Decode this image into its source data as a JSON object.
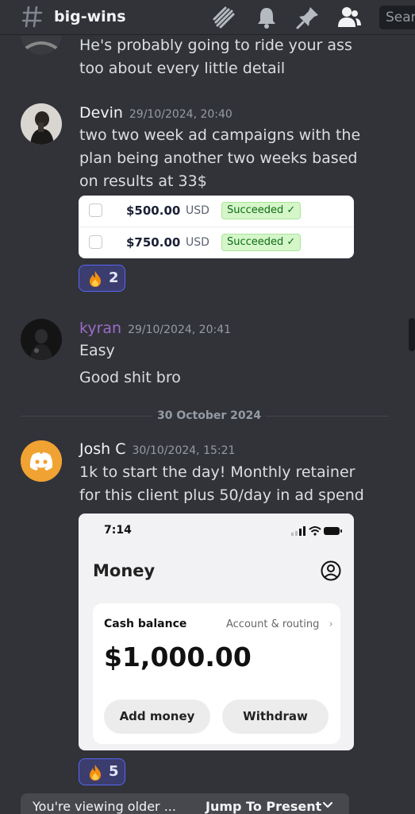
{
  "header": {
    "channel_name": "big-wins",
    "search_placeholder": "Sear"
  },
  "top_message": {
    "text_line1": "He's probably going to ride your ass",
    "text_line2": "too about every little detail"
  },
  "msg_devin": {
    "author": "Devin",
    "author_color": "#f2f3f5",
    "timestamp": "29/10/2024, 20:40",
    "line1": "two two week ad campaigns with the",
    "line2": "plan being another two weeks based",
    "line3": "on results at 33$",
    "payments": [
      {
        "amount": "$500.00",
        "currency": "USD",
        "status": "Succeeded ✓"
      },
      {
        "amount": "$750.00",
        "currency": "USD",
        "status": "Succeeded ✓"
      }
    ],
    "reaction": {
      "emoji": "fire-emoji",
      "count": "2"
    }
  },
  "msg_kyran": {
    "author": "kyran",
    "author_color": "#9b6cc7",
    "timestamp": "29/10/2024, 20:41",
    "line1": "Easy",
    "line2": "Good shit bro"
  },
  "date_divider": "30 October 2024",
  "msg_josh": {
    "author": "Josh C",
    "author_color": "#f2f3f5",
    "timestamp": "30/10/2024, 15:21",
    "line1": "1k to start the day! Monthly retainer",
    "line2": "for this client plus 50/day in ad spend",
    "avatar_color": "#f0a232",
    "phone": {
      "time": "7:14",
      "title": "Money",
      "cash_label": "Cash balance",
      "account_link": "Account & routing",
      "chevron": "›",
      "balance": "$1,000.00",
      "add_money": "Add money",
      "withdraw": "Withdraw"
    },
    "reaction": {
      "emoji": "fire-emoji",
      "count": "5"
    }
  },
  "bottom_bar": {
    "older_text": "You're viewing older ...",
    "jump_label": "Jump To Present"
  }
}
